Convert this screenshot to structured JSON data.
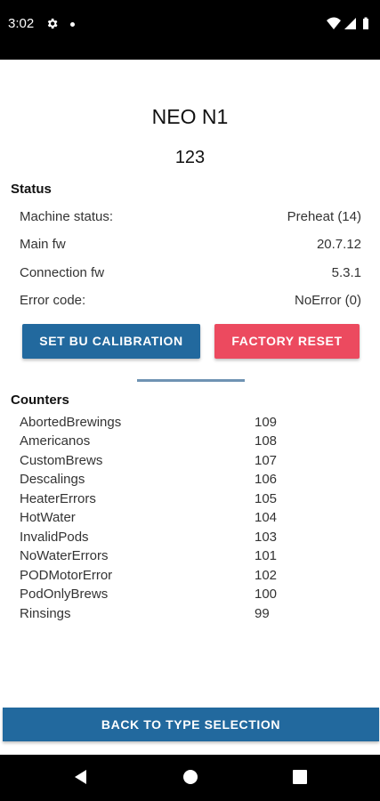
{
  "status_bar": {
    "time": "3:02",
    "icons": [
      "gear-icon",
      "notification-dot-icon",
      "wifi-icon",
      "signal-icon",
      "battery-icon"
    ]
  },
  "header": {
    "title": "NEO N1",
    "serial": "123"
  },
  "status_section": {
    "title": "Status",
    "rows": [
      {
        "label": "Machine status:",
        "value": "Preheat (14)"
      },
      {
        "label": "Main fw",
        "value": "20.7.12"
      },
      {
        "label": "Connection fw",
        "value": "5.3.1"
      },
      {
        "label": "Error code:",
        "value": "NoError (0)"
      }
    ]
  },
  "actions": {
    "calibration_label": "SET BU CALIBRATION",
    "reset_label": "FACTORY RESET"
  },
  "counters_section": {
    "title": "Counters",
    "rows": [
      {
        "label": "AbortedBrewings",
        "value": "109"
      },
      {
        "label": "Americanos",
        "value": "108"
      },
      {
        "label": "CustomBrews",
        "value": "107"
      },
      {
        "label": "Descalings",
        "value": "106"
      },
      {
        "label": "HeaterErrors",
        "value": "105"
      },
      {
        "label": "HotWater",
        "value": "104"
      },
      {
        "label": "InvalidPods",
        "value": "103"
      },
      {
        "label": "NoWaterErrors",
        "value": "101"
      },
      {
        "label": "PODMotorError",
        "value": "102"
      },
      {
        "label": "PodOnlyBrews",
        "value": "100"
      },
      {
        "label": "Rinsings",
        "value": "99"
      }
    ]
  },
  "footer": {
    "back_label": "BACK TO TYPE SELECTION"
  },
  "nav": {
    "icons": [
      "back-icon",
      "home-icon",
      "recents-icon"
    ]
  },
  "colors": {
    "primary": "#22699e",
    "danger": "#ec4a5f",
    "divider": "#6f93b3"
  }
}
